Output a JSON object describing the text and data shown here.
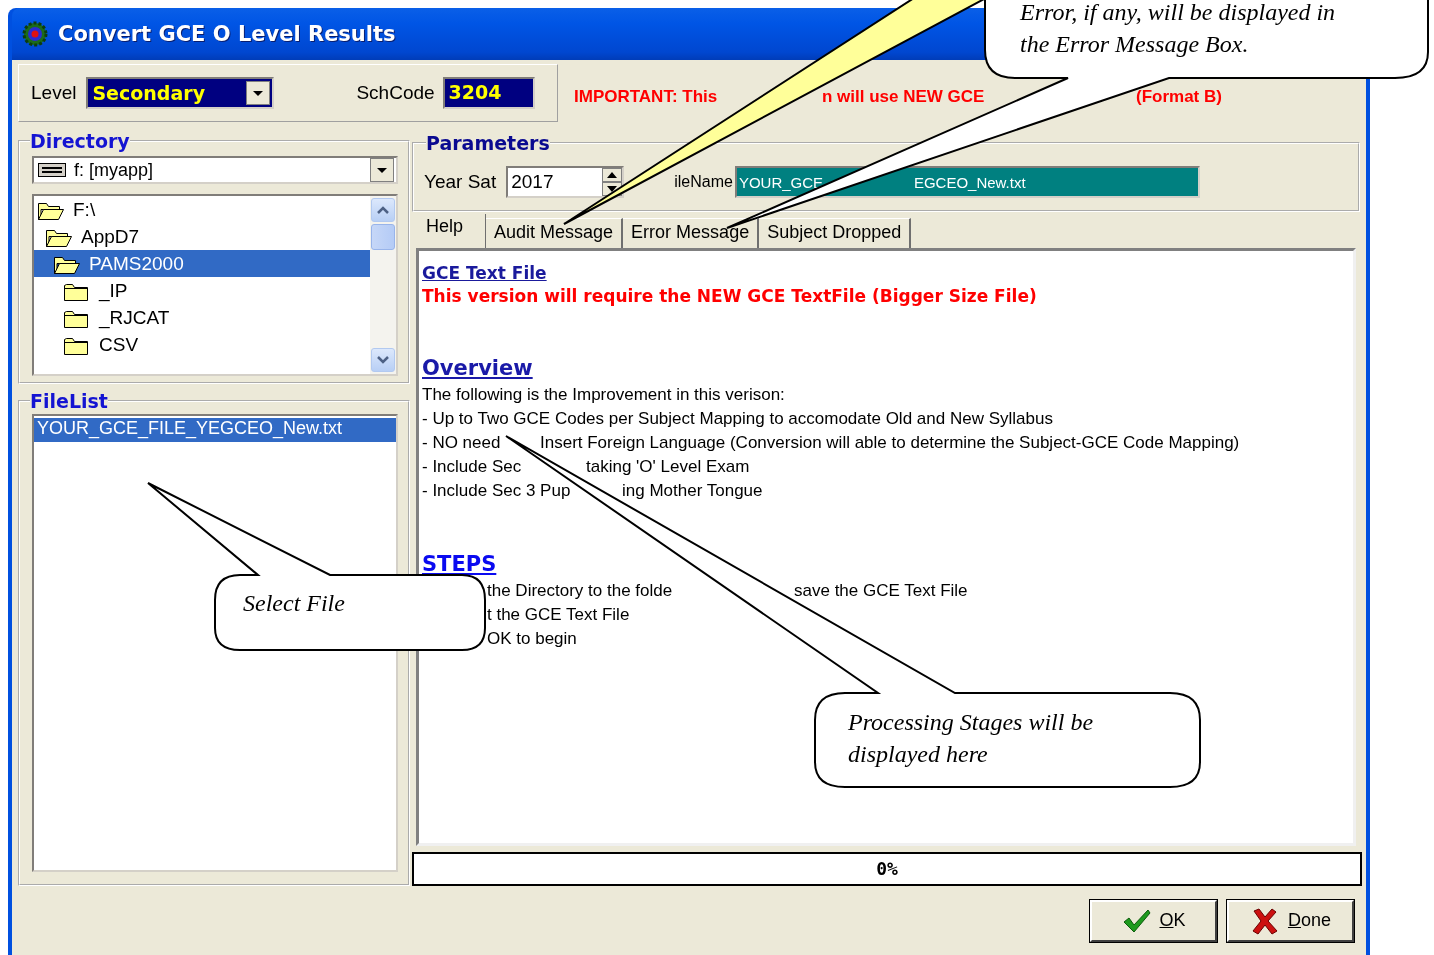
{
  "window": {
    "title": "Convert GCE O Level Results"
  },
  "top_bar": {
    "level_label": "Level",
    "level_value": "Secondary",
    "schcode_label": "SchCode",
    "schcode_value": "3204",
    "notice": [
      "IMPORTANT: This",
      "n will use NEW GCE",
      "(Format B)"
    ]
  },
  "directory": {
    "title": "Directory",
    "drive": "f: [myapp]",
    "tree": [
      {
        "label": "F:\\",
        "expanded": true,
        "selected": false,
        "children": [
          {
            "label": "AppD7",
            "expanded": true,
            "selected": false,
            "children": [
              {
                "label": "PAMS2000",
                "expanded": true,
                "selected": true,
                "children": [
                  {
                    "label": "_IP",
                    "expanded": false,
                    "selected": false
                  },
                  {
                    "label": "_RJCAT",
                    "expanded": false,
                    "selected": false
                  },
                  {
                    "label": "CSV",
                    "expanded": false,
                    "selected": false
                  }
                ]
              }
            ]
          }
        ]
      }
    ]
  },
  "file_list": {
    "title": "FileList",
    "items": [
      {
        "label": "YOUR_GCE_FILE_YEGCEO_New.txt",
        "selected": true
      }
    ]
  },
  "parameters": {
    "title": "Parameters",
    "year_label": "Year Sat",
    "year_value": "2017",
    "filename_label": "ileName",
    "filename_value": [
      "YOUR_GCE",
      "EGCEO_New.txt"
    ]
  },
  "tabs": [
    {
      "label": "Help",
      "selected": true
    },
    {
      "label": "Audit Message",
      "selected": false
    },
    {
      "label": "Error Message",
      "selected": false
    },
    {
      "label": "Subject Dropped",
      "selected": false
    }
  ],
  "help": [
    {
      "kind": "link",
      "parts": [
        "GCE Text File"
      ]
    },
    {
      "kind": "alert",
      "parts": [
        "This version will require the NEW GCE TextFile (Bigger Size File)"
      ]
    },
    {
      "kind": "heading",
      "parts": [
        "Overview"
      ]
    },
    {
      "kind": "text",
      "parts": [
        "The following is the Improvement in this verison:"
      ]
    },
    {
      "kind": "text",
      "parts": [
        "- Up to Two GCE Codes per Subject Mapping to accomodate Old and New Syllabus"
      ]
    },
    {
      "kind": "text",
      "parts": [
        "- NO need",
        "Insert Foreign Language (Conversion will able to determine the Subject-GCE Code Mapping)"
      ]
    },
    {
      "kind": "text",
      "parts": [
        "- Include Sec",
        "taking 'O' Level Exam"
      ]
    },
    {
      "kind": "text",
      "parts": [
        "- Include Sec 3 Pup",
        "ing Mother Tongue"
      ]
    },
    {
      "kind": "heading",
      "parts": [
        "STEPS"
      ]
    },
    {
      "kind": "step",
      "parts": [
        "the Directory to the folde",
        "save the GCE Text File"
      ]
    },
    {
      "kind": "step",
      "parts": [
        "t the GCE Text File"
      ]
    },
    {
      "kind": "step",
      "parts": [
        "OK to begin"
      ]
    }
  ],
  "progress": {
    "level": 0,
    "text": "0%"
  },
  "buttons": [
    {
      "kind": "ok",
      "label": "OK"
    },
    {
      "kind": "done",
      "label": "Done"
    }
  ],
  "callouts": [
    {
      "kind": "error",
      "lines": [
        "Error, if any, will be displayed in",
        "the Error Message Box."
      ]
    },
    {
      "kind": "file",
      "lines": [
        "Select File"
      ]
    },
    {
      "kind": "stages",
      "lines": [
        "Processing Stages will be",
        "displayed here"
      ]
    }
  ]
}
